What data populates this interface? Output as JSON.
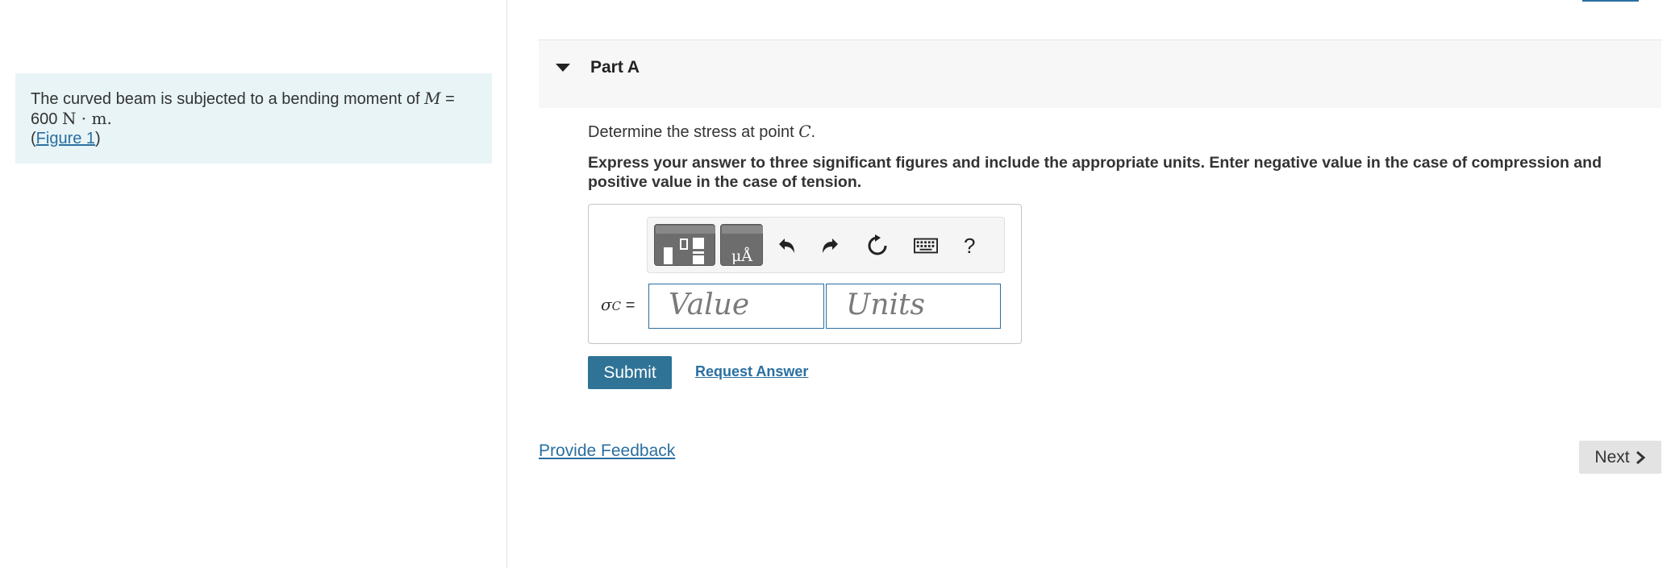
{
  "problem": {
    "text_prefix": "The curved beam is subjected to a bending moment of ",
    "var_m": "M",
    "equals": " =",
    "value": "600",
    "unit": "N · m.",
    "figure_open": "(",
    "figure_link": "Figure 1",
    "figure_close": ")"
  },
  "part": {
    "title": "Part A",
    "prompt_prefix": "Determine the stress at point ",
    "prompt_point": "C",
    "prompt_suffix": ".",
    "instructions": "Express your answer to three significant figures and include the appropriate units. Enter negative value in the case of compression and positive value in the case of tension."
  },
  "answer": {
    "symbol": "σ",
    "subscript": "C",
    "equals": " =",
    "value_placeholder": "Value",
    "units_placeholder": "Units"
  },
  "toolbar": {
    "units_glyph": "μÅ",
    "help": "?"
  },
  "actions": {
    "submit": "Submit",
    "request_answer": "Request Answer",
    "provide_feedback": "Provide Feedback",
    "next": "Next"
  }
}
